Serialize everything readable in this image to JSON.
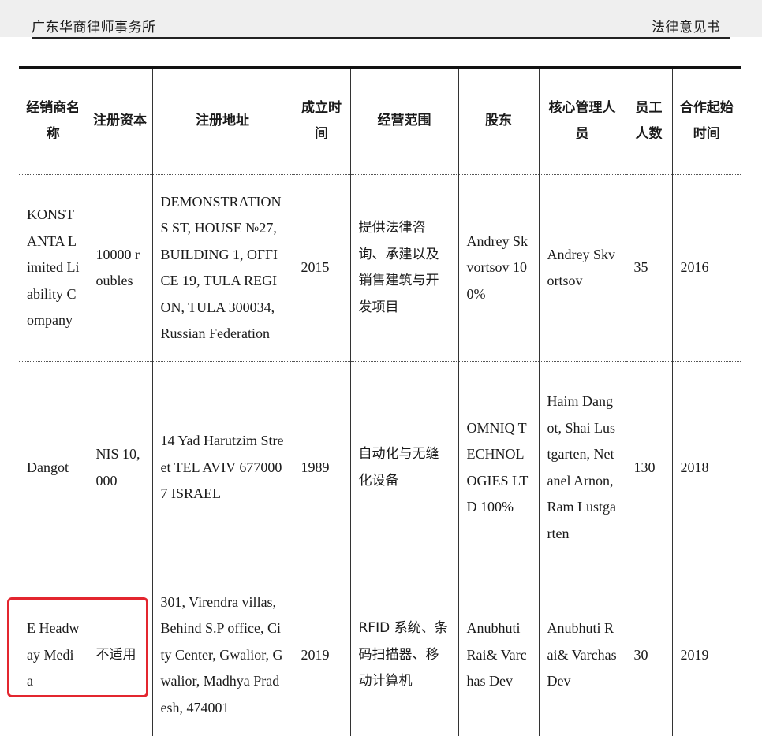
{
  "header": {
    "left": "广东华商律师事务所",
    "right": "法律意见书"
  },
  "table": {
    "columns": [
      "经销商名称",
      "注册资本",
      "注册地址",
      "成立时间",
      "经营范围",
      "股东",
      "核心管理人员",
      "员工人数",
      "合作起始时间"
    ],
    "rows": [
      {
        "name": "KONSTANTA Limited Liability Company",
        "capital": "10000 roubles",
        "address": "DEMONSTRATIONS ST, HOUSE №27, BUILDING 1, OFFICE 19, TULA REGION, TULA 300034, Russian Federation",
        "founded": "2015",
        "scope": "提供法律咨询、承建以及销售建筑与开发项目",
        "shareholder": "Andrey Skvortsov 100%",
        "management": "Andrey Skvortsov",
        "employees": "35",
        "start": "2016"
      },
      {
        "name": "Dangot",
        "capital": "NIS 10,000",
        "address": "14 Yad Harutzim Street TEL AVIV 6770007 ISRAEL",
        "founded": "1989",
        "scope": "自动化与无缝化设备",
        "shareholder": "OMNIQ TECHNOLOGIES LTD 100%",
        "management": "Haim Dangot, Shai Lustgarten, Netanel Arnon, Ram Lustgarten",
        "employees": "130",
        "start": "2018"
      },
      {
        "name": "E Headway Media",
        "capital": "不适用",
        "address": "301, Virendra villas, Behind S.P office, City Center, Gwalior, Gwalior, Madhya Pradesh, 474001",
        "founded": "2019",
        "scope": "RFID 系统、条码扫描器、移动计算机",
        "shareholder": "Anubhuti Rai& Varchas Dev",
        "management": "Anubhuti Rai& Varchas Dev",
        "employees": "30",
        "start": "2019"
      }
    ]
  }
}
